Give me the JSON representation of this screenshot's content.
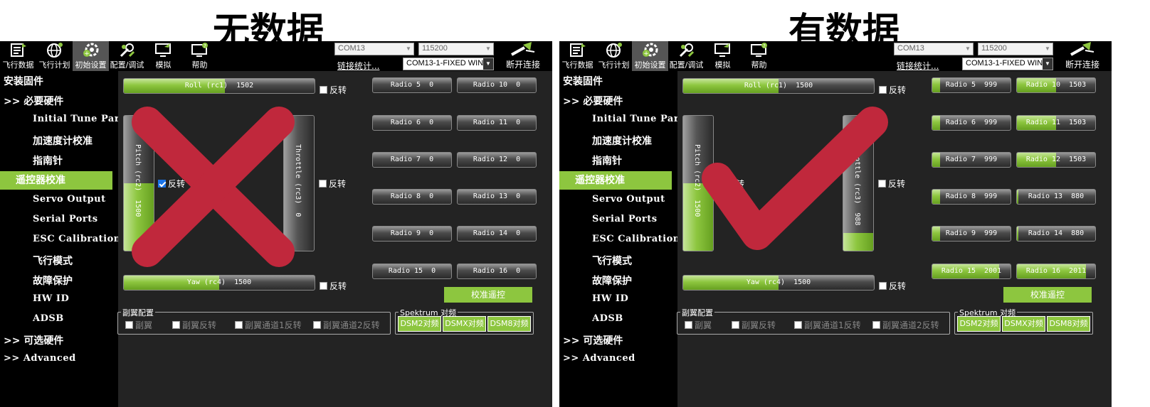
{
  "headings": {
    "left": "无数据",
    "right": "有数据"
  },
  "toolbar": {
    "items": [
      {
        "label": "飞行数据",
        "icon": "flight-data-icon"
      },
      {
        "label": "飞行计划",
        "icon": "flight-plan-icon"
      },
      {
        "label": "初始设置",
        "icon": "initial-setup-icon"
      },
      {
        "label": "配置/调试",
        "icon": "config-tuning-icon"
      },
      {
        "label": "模拟",
        "icon": "simulation-icon"
      },
      {
        "label": "帮助",
        "icon": "help-icon"
      }
    ],
    "com_port": "COM13",
    "baud_rate": "115200",
    "link_stats": "链接统计...",
    "connection": "COM13-1-FIXED WING",
    "disconnect": "断开连接"
  },
  "sidebar": [
    "安装固件",
    ">> 必要硬件",
    "Initial Tune Parameters",
    "加速度计校准",
    "指南针",
    "遥控器校准",
    "Servo Output",
    "Serial Ports",
    "ESC Calibration",
    "飞行模式",
    "故障保护",
    "HW ID",
    "ADSB",
    ">> 可选硬件",
    ">> Advanced"
  ],
  "reverse_label": "反转",
  "calibrate_button": "校准遥控",
  "secondary_aileron": {
    "title": "副翼配置",
    "options": [
      "副翼",
      "副翼反转",
      "副翼通道1反转",
      "副翼通道2反转"
    ]
  },
  "spektrum": {
    "title": "Spektrum 对频",
    "buttons": [
      "DSM2对频",
      "DSMX对频",
      "DSM8对频"
    ]
  },
  "left_panel": {
    "roll": "Roll (rc1)  1502",
    "roll_fill": 0.53,
    "pitch": "Pitch (rc2)  1500",
    "pitch_fill": 0.5,
    "pitch_reverse_checked": true,
    "throttle": "Throttle (rc3)  0",
    "throttle_fill": 0,
    "yaw": "Yaw (rc4)  1500",
    "yaw_fill": 0.5,
    "radios": [
      {
        "label": "Radio 5  0",
        "fill": 0
      },
      {
        "label": "Radio 10  0",
        "fill": 0
      },
      {
        "label": "Radio 6  0",
        "fill": 0
      },
      {
        "label": "Radio 11  0",
        "fill": 0
      },
      {
        "label": "Radio 7  0",
        "fill": 0
      },
      {
        "label": "Radio 12  0",
        "fill": 0
      },
      {
        "label": "Radio 8  0",
        "fill": 0
      },
      {
        "label": "Radio 13  0",
        "fill": 0
      },
      {
        "label": "Radio 9  0",
        "fill": 0
      },
      {
        "label": "Radio 14  0",
        "fill": 0
      },
      {
        "label": "Radio 15  0",
        "fill": 0
      },
      {
        "label": "Radio 16  0",
        "fill": 0
      }
    ]
  },
  "right_panel": {
    "roll": "Roll (rc1)  1500",
    "roll_fill": 0.5,
    "pitch": "Pitch (rc2)  1500",
    "pitch_fill": 0.5,
    "pitch_reverse_checked": false,
    "throttle": "Throttle (rc3)  988",
    "throttle_fill": 0.13,
    "yaw": "Yaw (rc4)  1500",
    "yaw_fill": 0.5,
    "radios": [
      {
        "label": "Radio 5  999",
        "fill": 0.1
      },
      {
        "label": "Radio 10  1503",
        "fill": 0.5
      },
      {
        "label": "Radio 6  999",
        "fill": 0.1
      },
      {
        "label": "Radio 11  1503",
        "fill": 0.5
      },
      {
        "label": "Radio 7  999",
        "fill": 0.1
      },
      {
        "label": "Radio 12  1503",
        "fill": 0.5
      },
      {
        "label": "Radio 8  999",
        "fill": 0.1
      },
      {
        "label": "Radio 13  880",
        "fill": 0.02
      },
      {
        "label": "Radio 9  999",
        "fill": 0.1
      },
      {
        "label": "Radio 14  880",
        "fill": 0.02
      },
      {
        "label": "Radio 15  2001",
        "fill": 0.85
      },
      {
        "label": "Radio 16  2011",
        "fill": 0.88
      }
    ]
  },
  "marks": {
    "left": "cross-mark",
    "right": "check-mark",
    "color": "#c0283c"
  }
}
